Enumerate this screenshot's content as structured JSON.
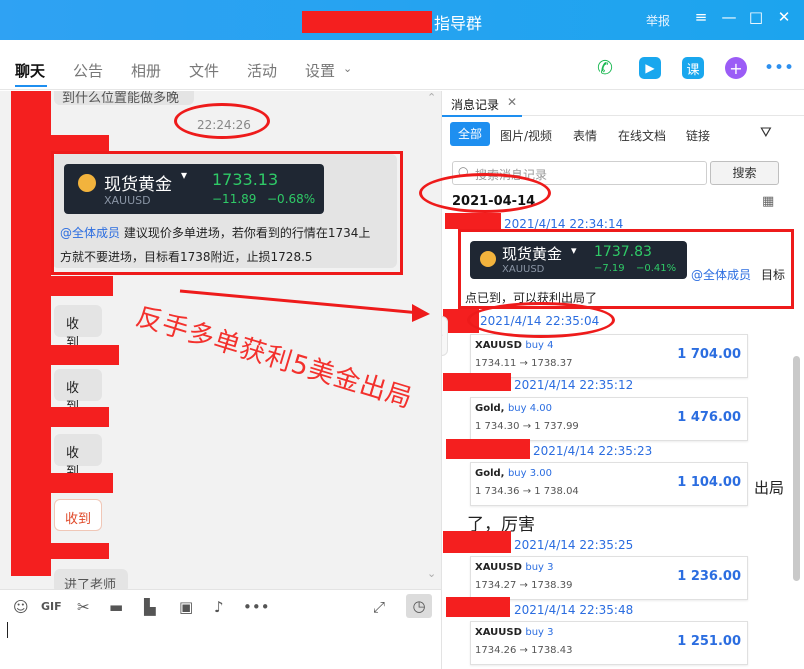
{
  "window": {
    "title": "指导群",
    "report": "举报",
    "controls": [
      "≡",
      "—",
      "□",
      "✕"
    ]
  },
  "tabs": [
    "聊天",
    "公告",
    "相册",
    "文件",
    "活动",
    "设置"
  ],
  "chat": {
    "top_partial": "到什么位置能做多晚",
    "time": "22:24:26",
    "card": {
      "name": "现货黄金",
      "symbol": "XAUUSD",
      "price": "1733.13",
      "change": "−11.89",
      "pct": "−0.68%"
    },
    "message_line1": "@全体成员 建议现价少单进场，若你看到的行情在1734上",
    "message_line1_mention": "@全体成员",
    "message_line1_rest": " 建议现价多单进场，若你看到的行情在1734上",
    "message_line2": "方就不要进场，目标看1738附近，止损1728.5",
    "replies": [
      "收到",
      "收到",
      "收到",
      "收到"
    ],
    "bottom_partial": "进了老师",
    "overlay": "反手多单获利5美金出局"
  },
  "history": {
    "title": "消息记录",
    "filter_tabs": [
      "全部",
      "图片/视频",
      "表情",
      "在线文档",
      "链接"
    ],
    "search_placeholder": "搜索消息记录",
    "search_button": "搜索",
    "date": "2021-04-14",
    "stamps": [
      "2021/4/14 22:34:14",
      "2021/4/14 22:35:04",
      "2021/4/14 22:35:12",
      "2021/4/14 22:35:23",
      "2021/4/14 22:35:25",
      "2021/4/14 22:35:48"
    ],
    "card": {
      "name": "现货黄金",
      "symbol": "XAUUSD",
      "price": "1737.83",
      "change": "−7.19",
      "pct": "−0.41%",
      "mention": "@全体成员",
      "suffix": "目标"
    },
    "profit_text": "点已到，可以获利出局了",
    "trades": [
      {
        "sym": "XAUUSD",
        "side": "buy 4",
        "range": "1734.11 → 1738.37",
        "amount": "1 704.00"
      },
      {
        "sym": "Gold,",
        "side": "buy 4.00",
        "range": "1 734.30 → 1 737.99",
        "amount": "1 476.00"
      },
      {
        "sym": "Gold,",
        "side": "buy 3.00",
        "range": "1 734.36 → 1 738.04",
        "amount": "1 104.00"
      },
      {
        "sym": "XAUUSD",
        "side": "buy 3",
        "range": "1734.27 → 1738.39",
        "amount": "1 236.00"
      },
      {
        "sym": "XAUUSD",
        "side": "buy 3",
        "range": "1734.26 → 1738.43",
        "amount": "1 251.00"
      }
    ],
    "side_text_1": "出局",
    "side_text_2": "了，厉害"
  },
  "colors": {
    "titlebar": "#2fa2f3",
    "accent": "#1e8ff0",
    "annotation_red": "#ee1b1b",
    "gain_green": "#2fca67"
  }
}
